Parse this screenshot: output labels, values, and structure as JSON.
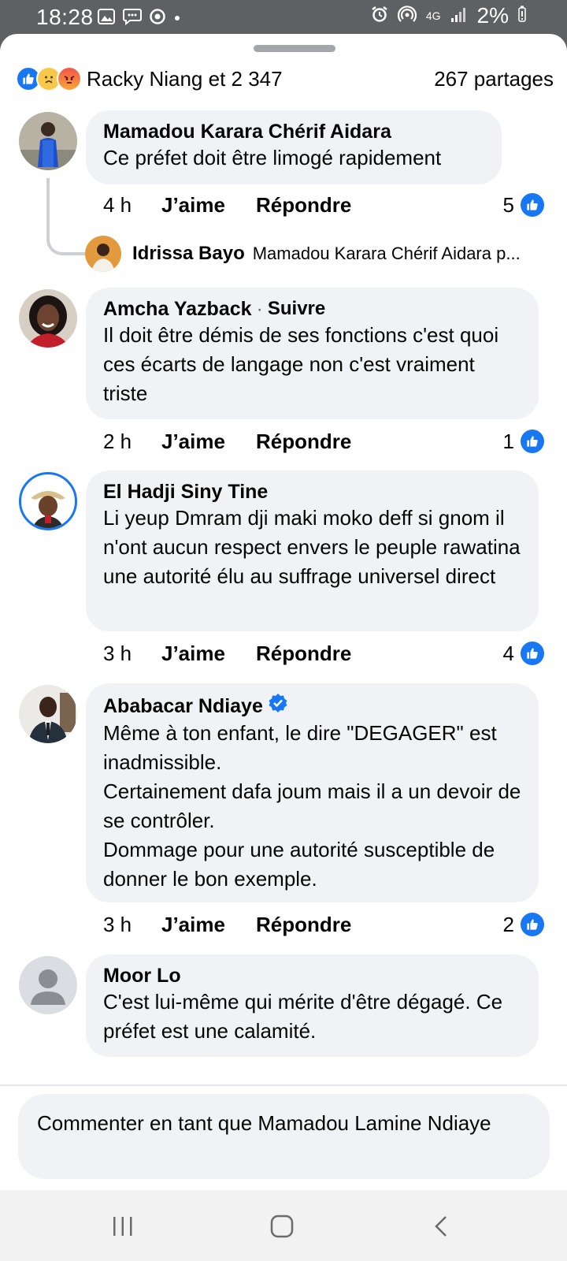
{
  "status_bar": {
    "time": "18:28",
    "battery": "2%",
    "network": "4G"
  },
  "reactions": {
    "text": "Racky Niang et 2 347",
    "shares": "267 partages"
  },
  "comments": [
    {
      "author": "Mamadou Karara Chérif Aidara",
      "text": "Ce préfet doit être limogé rapidement",
      "age": "4 h",
      "like": "J’aime",
      "reply": "Répondre",
      "likes": "5"
    },
    {
      "author": "Amcha Yazback",
      "follow": "Suivre",
      "text": "Il doit être démis de ses fonctions c'est quoi ces écarts de langage non c'est vraiment triste",
      "age": "2 h",
      "like": "J’aime",
      "reply": "Répondre",
      "likes": "1"
    },
    {
      "author": "El Hadji Siny Tine",
      "text": "Li yeup Dmram dji maki moko deff si gnom il n'ont aucun respect envers le peuple rawatina une autorité élu au suffrage universel direct",
      "age": "3 h",
      "like": "J’aime",
      "reply": "Répondre",
      "likes": "4"
    },
    {
      "author": "Ababacar Ndiaye",
      "text": "Même à ton enfant, le dire \"DEGAGER\" est inadmissible.\nCertainement dafa joum mais il a un devoir de se contrôler.\nDommage pour une autorité susceptible de donner le bon exemple.",
      "age": "3 h",
      "like": "J’aime",
      "reply": "Répondre",
      "likes": "2"
    },
    {
      "author": "Moor Lo",
      "text": "C'est lui-même qui mérite d'être dégagé. Ce préfet est une calamité."
    }
  ],
  "reply_preview": {
    "author": "Idrissa Bayo",
    "snippet": "Mamadou Karara Chérif Aidara p..."
  },
  "composer": {
    "placeholder": "Commenter en tant que Mamadou Lamine Ndiaye"
  },
  "colors": {
    "accent": "#1877f2",
    "bubble": "#f0f2f5"
  }
}
